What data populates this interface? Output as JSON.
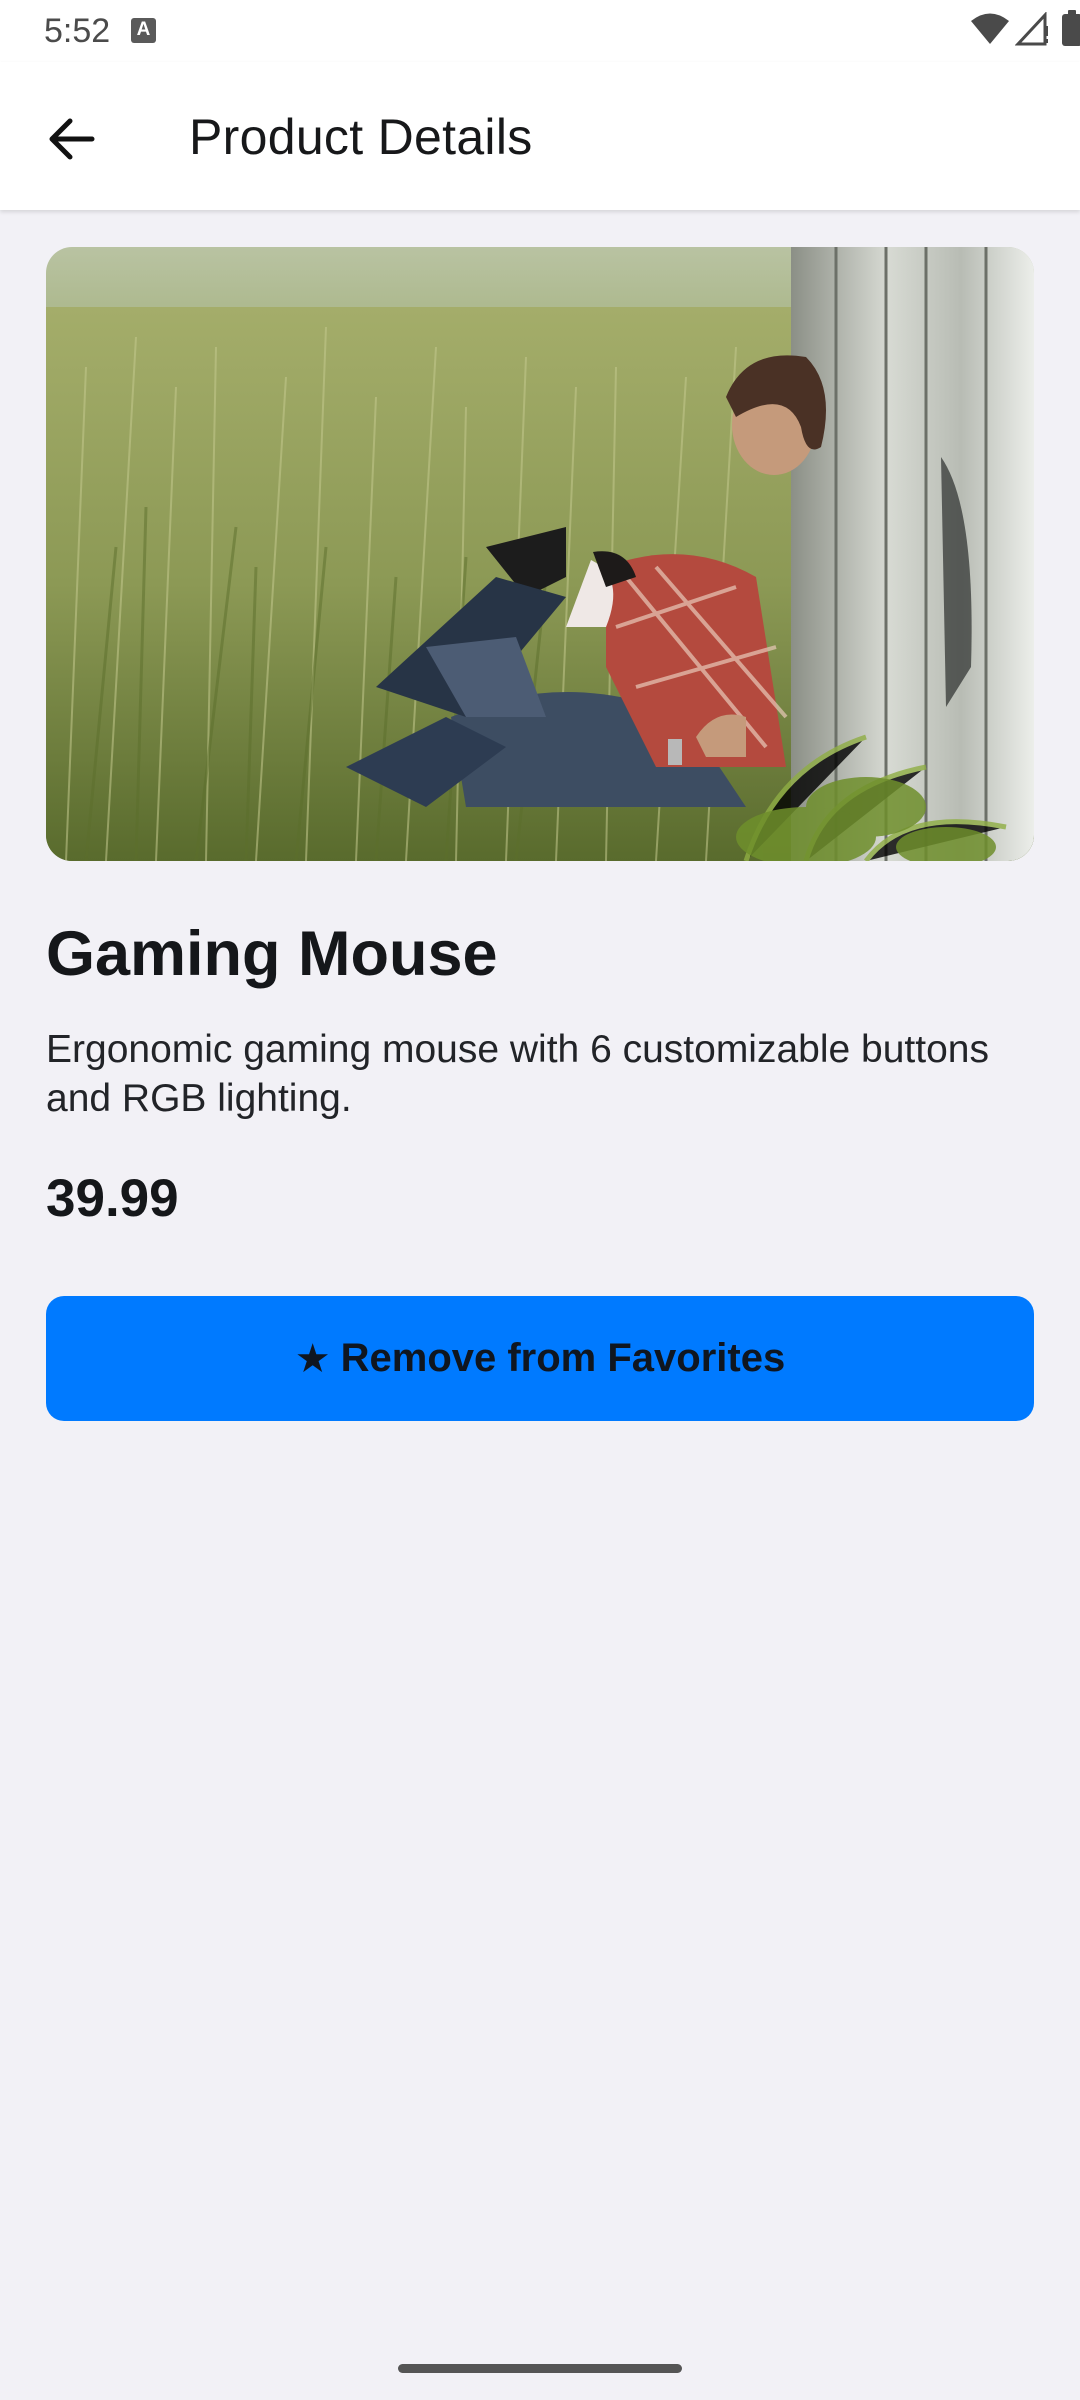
{
  "status_bar": {
    "time": "5:52",
    "icons": [
      "a-notification-icon",
      "wifi-icon",
      "signal-icon",
      "battery-icon"
    ]
  },
  "app_bar": {
    "title": "Product Details",
    "back_icon": "arrow-left-icon"
  },
  "product": {
    "name": "Gaming Mouse",
    "description": "Ergonomic gaming mouse with 6 customizable buttons and RGB lighting.",
    "price": "39.99",
    "image_alt": "Product photo"
  },
  "actions": {
    "favorite_icon": "★",
    "favorite_label": "Remove from Favorites"
  },
  "colors": {
    "accent": "#007aff",
    "background": "#f2f1f6",
    "surface": "#ffffff",
    "text": "#15171a"
  }
}
